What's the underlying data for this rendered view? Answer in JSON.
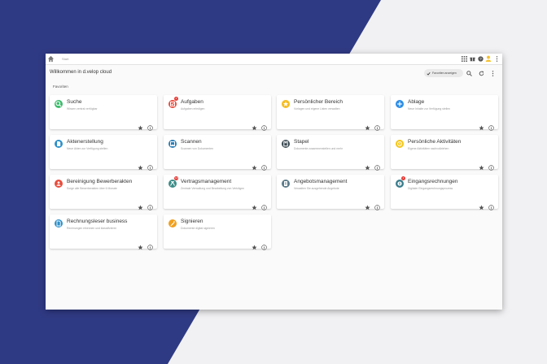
{
  "colors": {
    "navy": "#2f3a84",
    "accent_yellow": "#f6c02a",
    "badge_red": "#e53935"
  },
  "breadcrumb": {
    "current": "Start"
  },
  "header": {
    "title": "Willkommen in d.velop cloud",
    "favorites_button": "Favoriten anzeigen"
  },
  "section": {
    "title": "Favoriten"
  },
  "tiles": [
    {
      "title": "Suche",
      "subtitle": "Wissen zentral verfügbar",
      "icon": "search-icon",
      "color": "#3dbb6c",
      "badge": ""
    },
    {
      "title": "Aufgaben",
      "subtitle": "Aufgaben erledigen",
      "icon": "task-icon",
      "color": "#e84d3d",
      "badge": "4"
    },
    {
      "title": "Persönlicher Bereich",
      "subtitle": "Vorlagen und eigene Listen verwalten",
      "icon": "star-icon",
      "color": "#f5bd22",
      "badge": ""
    },
    {
      "title": "Ablage",
      "subtitle": "Neue Inhalte zur Verfügung stellen",
      "icon": "plus-icon",
      "color": "#2d8de6",
      "badge": ""
    },
    {
      "title": "Aktenerstellung",
      "subtitle": "Neue Akten zur Verfügung stellen",
      "icon": "file-add-icon",
      "color": "#2b8fc9",
      "badge": ""
    },
    {
      "title": "Scannen",
      "subtitle": "Scannen von Dokumenten",
      "icon": "scanner-icon",
      "color": "#2b7fb8",
      "badge": ""
    },
    {
      "title": "Stapel",
      "subtitle": "Dokumente zusammenstellen und mehr",
      "icon": "stack-icon",
      "color": "#37474f",
      "badge": ""
    },
    {
      "title": "Persönliche Aktivitäten",
      "subtitle": "Eigene Aktivitäten nachvollziehen",
      "icon": "activity-icon",
      "color": "#f5c518",
      "badge": ""
    },
    {
      "title": "Bereinigung Bewerberakten",
      "subtitle": "Sorge alle Bewerberakten über 6 Monate",
      "icon": "person-icon",
      "color": "#e84d3d",
      "badge": ""
    },
    {
      "title": "Vertragsmanagement",
      "subtitle": "Zentrale Verwaltung und Bearbeitung von Verträgen",
      "icon": "contract-icon",
      "color": "#3c8c87",
      "badge": "12"
    },
    {
      "title": "Angebotsmanagement",
      "subtitle": "Verwalten Sie ausgehende Angebote",
      "icon": "offer-icon",
      "color": "#5d7b8a",
      "badge": ""
    },
    {
      "title": "Eingangsrechnungen",
      "subtitle": "Digitaler Eingangsrechnungsprozess",
      "icon": "invoice-icon",
      "color": "#3a7d8c",
      "badge": "1"
    },
    {
      "title": "Rechnungsleser business",
      "subtitle": "Rechnungen erkennen und klassifizieren",
      "icon": "reader-icon",
      "color": "#2b8fc9",
      "badge": ""
    },
    {
      "title": "Signieren",
      "subtitle": "Dokumente digital signieren",
      "icon": "signature-icon",
      "color": "#f0a020",
      "badge": ""
    }
  ]
}
